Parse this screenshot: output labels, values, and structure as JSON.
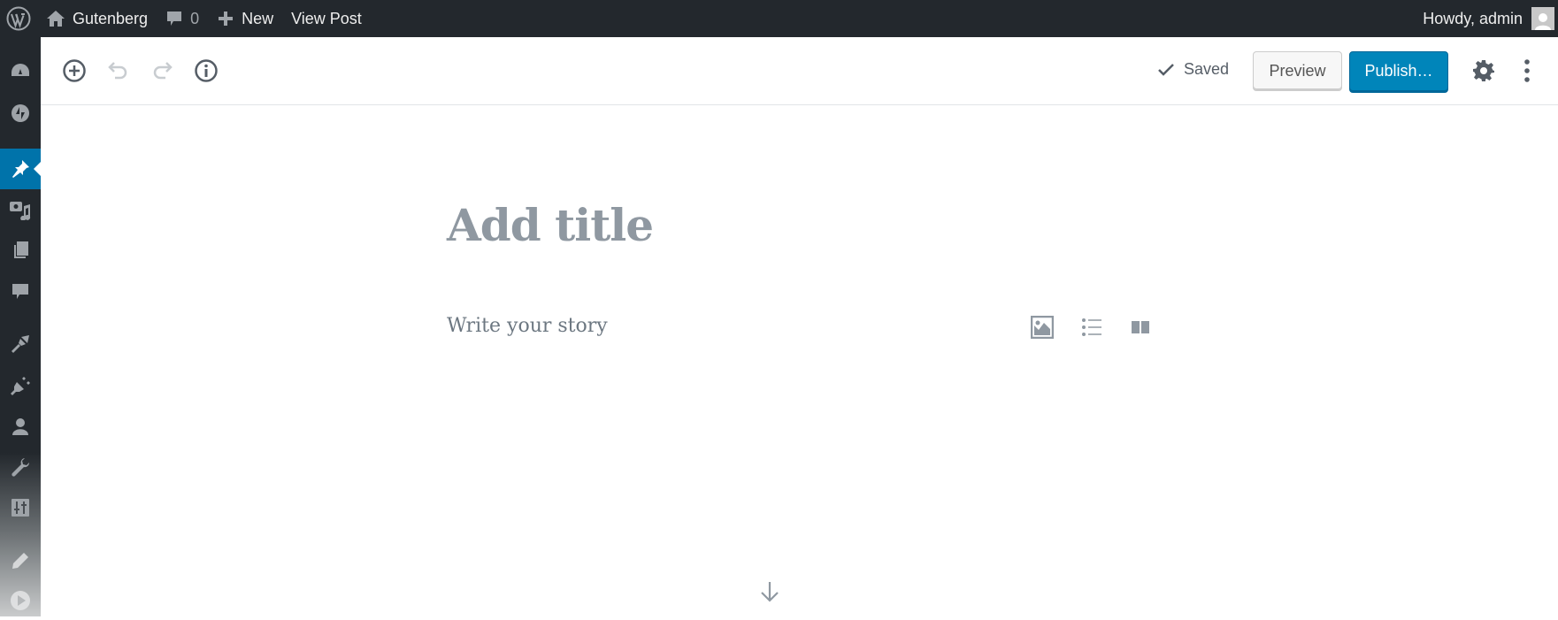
{
  "admin_bar": {
    "wp_logo_icon": "wordpress-logo-icon",
    "site_name": "Gutenberg",
    "comments_count": "0",
    "new_label": "New",
    "view_post_label": "View Post",
    "greeting": "Howdy, admin"
  },
  "admin_menu": {
    "items": [
      {
        "name": "dashboard",
        "icon": "dashboard-icon"
      },
      {
        "name": "jetpack",
        "icon": "jetpack-icon"
      },
      {
        "name": "posts",
        "icon": "pin-icon",
        "current": true
      },
      {
        "name": "media",
        "icon": "media-icon"
      },
      {
        "name": "pages",
        "icon": "pages-icon"
      },
      {
        "name": "comments",
        "icon": "comment-icon"
      },
      {
        "name": "appearance",
        "icon": "brush-icon"
      },
      {
        "name": "plugins",
        "icon": "plugin-icon"
      },
      {
        "name": "users",
        "icon": "user-icon"
      },
      {
        "name": "tools",
        "icon": "wrench-icon"
      },
      {
        "name": "settings",
        "icon": "settings-sliders-icon"
      },
      {
        "name": "gutenberg",
        "icon": "pencil-icon"
      },
      {
        "name": "collapse",
        "icon": "play-circle-icon"
      }
    ]
  },
  "editor_header": {
    "saved_label": "Saved",
    "preview_label": "Preview",
    "publish_label": "Publish…",
    "accent_color": "#0085ba"
  },
  "content": {
    "title_placeholder": "Add title",
    "body_placeholder": "Write your story",
    "quick_inserters": [
      "image-icon",
      "list-icon",
      "columns-icon"
    ]
  }
}
